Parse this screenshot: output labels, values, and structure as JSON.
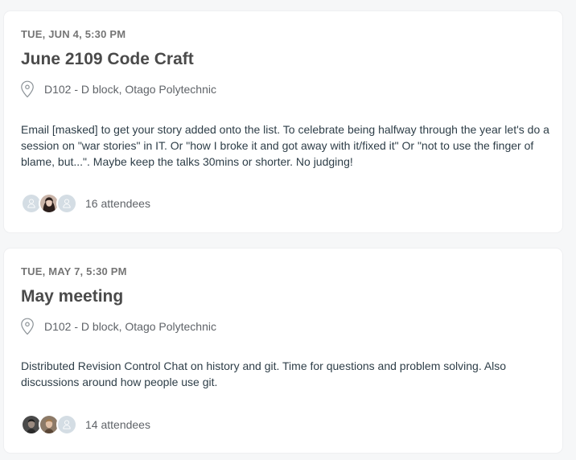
{
  "events": [
    {
      "date": "TUE, JUN 4, 5:30 PM",
      "title": "June 2109 Code Craft",
      "venue": "D102 - D block, Otago Polytechnic",
      "description": "Email [masked] to get your story added onto the list. To celebrate being halfway through the year let's do a session on \"war stories\" in IT. Or \"how I broke it and got away with it/fixed it\" Or \"not to use the finger of blame, but...\". Maybe keep the talks 30mins or shorter. No judging!",
      "attendees_label": "16 attendees",
      "avatars": [
        "placeholder-avatar",
        "photo-avatar-woman",
        "placeholder-avatar"
      ]
    },
    {
      "date": "TUE, MAY 7, 5:30 PM",
      "title": "May meeting",
      "venue": "D102 - D block, Otago Polytechnic",
      "description": "Distributed Revision Control Chat on history and git. Time for questions and problem solving. Also discussions around how people use git.",
      "attendees_label": "14 attendees",
      "avatars": [
        "photo-avatar-man",
        "photo-avatar-man",
        "placeholder-avatar"
      ]
    }
  ],
  "colors": {
    "page_background": "#f6f7f8",
    "card_background": "#ffffff",
    "title_text": "#4a4a4a",
    "secondary_text": "#757575",
    "placeholder_avatar": "#d4dde4"
  }
}
